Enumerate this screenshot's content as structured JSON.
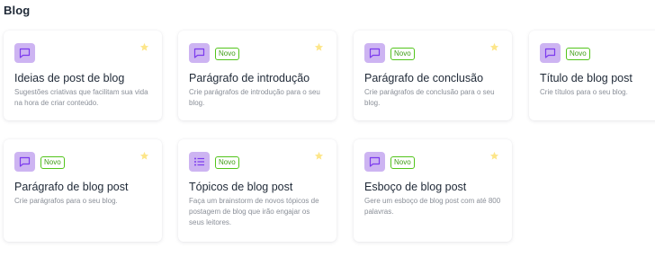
{
  "section": {
    "title": "Blog"
  },
  "colors": {
    "icon_bg": "#cdb4f2",
    "icon_stroke": "#7c3aed",
    "badge": "#52c41a",
    "star": "#fde68a"
  },
  "cards": [
    {
      "title": "Ideias de post de blog",
      "description": "Sugestões criativas que facilitam sua vida na hora de criar conteúdo.",
      "badge": "",
      "icon": "chat-bubble-icon"
    },
    {
      "title": "Parágrafo de introdução",
      "description": "Crie parágrafos de introdução para o seu blog.",
      "badge": "Novo",
      "icon": "chat-bubble-icon"
    },
    {
      "title": "Parágrafo de conclusão",
      "description": "Crie parágrafos de conclusão para o seu blog.",
      "badge": "Novo",
      "icon": "chat-bubble-icon"
    },
    {
      "title": "Título de blog post",
      "description": "Crie títulos para o seu blog.",
      "badge": "Novo",
      "icon": "chat-bubble-icon"
    },
    {
      "title": "Parágrafo de blog post",
      "description": "Crie parágrafos para o seu blog.",
      "badge": "Novo",
      "icon": "chat-bubble-icon"
    },
    {
      "title": "Tópicos de blog post",
      "description": "Faça um brainstorm de novos tópicos de postagem de blog que irão engajar os seus leitores.",
      "badge": "Novo",
      "icon": "list-icon"
    },
    {
      "title": "Esboço de blog post",
      "description": "Gere um esboço de blog post com até 800 palavras.",
      "badge": "Novo",
      "icon": "chat-bubble-icon"
    }
  ]
}
